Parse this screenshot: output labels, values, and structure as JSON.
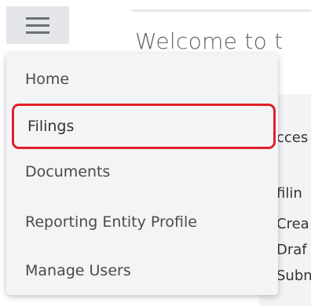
{
  "page": {
    "welcome_title": "Welcome to t",
    "side_fragments": [
      "cces",
      "filin",
      "Crea",
      "Draf",
      "Subn"
    ]
  },
  "header": {
    "menu_icon": "hamburger-menu-icon"
  },
  "menu": {
    "items": [
      {
        "label": "Home"
      },
      {
        "label": "Filings",
        "selected": true
      },
      {
        "label": "Documents"
      },
      {
        "label": "Reporting Entity Profile"
      },
      {
        "label": "Manage Users"
      }
    ]
  },
  "colors": {
    "highlight": "#e0202a",
    "menu_bg": "#f3f4f6",
    "toggle_bg": "#e4e6ea"
  }
}
